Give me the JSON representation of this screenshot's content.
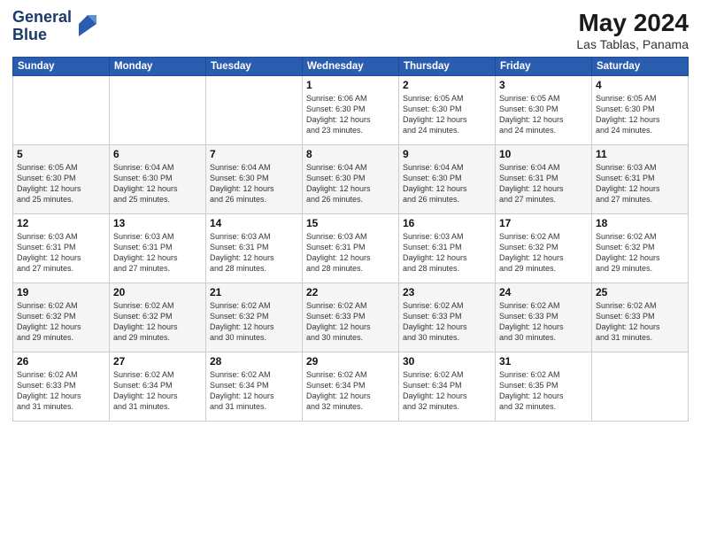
{
  "logo": {
    "line1": "General",
    "line2": "Blue"
  },
  "title": "May 2024",
  "subtitle": "Las Tablas, Panama",
  "weekdays": [
    "Sunday",
    "Monday",
    "Tuesday",
    "Wednesday",
    "Thursday",
    "Friday",
    "Saturday"
  ],
  "weeks": [
    [
      {
        "day": "",
        "info": ""
      },
      {
        "day": "",
        "info": ""
      },
      {
        "day": "",
        "info": ""
      },
      {
        "day": "1",
        "info": "Sunrise: 6:06 AM\nSunset: 6:30 PM\nDaylight: 12 hours\nand 23 minutes."
      },
      {
        "day": "2",
        "info": "Sunrise: 6:05 AM\nSunset: 6:30 PM\nDaylight: 12 hours\nand 24 minutes."
      },
      {
        "day": "3",
        "info": "Sunrise: 6:05 AM\nSunset: 6:30 PM\nDaylight: 12 hours\nand 24 minutes."
      },
      {
        "day": "4",
        "info": "Sunrise: 6:05 AM\nSunset: 6:30 PM\nDaylight: 12 hours\nand 24 minutes."
      }
    ],
    [
      {
        "day": "5",
        "info": "Sunrise: 6:05 AM\nSunset: 6:30 PM\nDaylight: 12 hours\nand 25 minutes."
      },
      {
        "day": "6",
        "info": "Sunrise: 6:04 AM\nSunset: 6:30 PM\nDaylight: 12 hours\nand 25 minutes."
      },
      {
        "day": "7",
        "info": "Sunrise: 6:04 AM\nSunset: 6:30 PM\nDaylight: 12 hours\nand 26 minutes."
      },
      {
        "day": "8",
        "info": "Sunrise: 6:04 AM\nSunset: 6:30 PM\nDaylight: 12 hours\nand 26 minutes."
      },
      {
        "day": "9",
        "info": "Sunrise: 6:04 AM\nSunset: 6:30 PM\nDaylight: 12 hours\nand 26 minutes."
      },
      {
        "day": "10",
        "info": "Sunrise: 6:04 AM\nSunset: 6:31 PM\nDaylight: 12 hours\nand 27 minutes."
      },
      {
        "day": "11",
        "info": "Sunrise: 6:03 AM\nSunset: 6:31 PM\nDaylight: 12 hours\nand 27 minutes."
      }
    ],
    [
      {
        "day": "12",
        "info": "Sunrise: 6:03 AM\nSunset: 6:31 PM\nDaylight: 12 hours\nand 27 minutes."
      },
      {
        "day": "13",
        "info": "Sunrise: 6:03 AM\nSunset: 6:31 PM\nDaylight: 12 hours\nand 27 minutes."
      },
      {
        "day": "14",
        "info": "Sunrise: 6:03 AM\nSunset: 6:31 PM\nDaylight: 12 hours\nand 28 minutes."
      },
      {
        "day": "15",
        "info": "Sunrise: 6:03 AM\nSunset: 6:31 PM\nDaylight: 12 hours\nand 28 minutes."
      },
      {
        "day": "16",
        "info": "Sunrise: 6:03 AM\nSunset: 6:31 PM\nDaylight: 12 hours\nand 28 minutes."
      },
      {
        "day": "17",
        "info": "Sunrise: 6:02 AM\nSunset: 6:32 PM\nDaylight: 12 hours\nand 29 minutes."
      },
      {
        "day": "18",
        "info": "Sunrise: 6:02 AM\nSunset: 6:32 PM\nDaylight: 12 hours\nand 29 minutes."
      }
    ],
    [
      {
        "day": "19",
        "info": "Sunrise: 6:02 AM\nSunset: 6:32 PM\nDaylight: 12 hours\nand 29 minutes."
      },
      {
        "day": "20",
        "info": "Sunrise: 6:02 AM\nSunset: 6:32 PM\nDaylight: 12 hours\nand 29 minutes."
      },
      {
        "day": "21",
        "info": "Sunrise: 6:02 AM\nSunset: 6:32 PM\nDaylight: 12 hours\nand 30 minutes."
      },
      {
        "day": "22",
        "info": "Sunrise: 6:02 AM\nSunset: 6:33 PM\nDaylight: 12 hours\nand 30 minutes."
      },
      {
        "day": "23",
        "info": "Sunrise: 6:02 AM\nSunset: 6:33 PM\nDaylight: 12 hours\nand 30 minutes."
      },
      {
        "day": "24",
        "info": "Sunrise: 6:02 AM\nSunset: 6:33 PM\nDaylight: 12 hours\nand 30 minutes."
      },
      {
        "day": "25",
        "info": "Sunrise: 6:02 AM\nSunset: 6:33 PM\nDaylight: 12 hours\nand 31 minutes."
      }
    ],
    [
      {
        "day": "26",
        "info": "Sunrise: 6:02 AM\nSunset: 6:33 PM\nDaylight: 12 hours\nand 31 minutes."
      },
      {
        "day": "27",
        "info": "Sunrise: 6:02 AM\nSunset: 6:34 PM\nDaylight: 12 hours\nand 31 minutes."
      },
      {
        "day": "28",
        "info": "Sunrise: 6:02 AM\nSunset: 6:34 PM\nDaylight: 12 hours\nand 31 minutes."
      },
      {
        "day": "29",
        "info": "Sunrise: 6:02 AM\nSunset: 6:34 PM\nDaylight: 12 hours\nand 32 minutes."
      },
      {
        "day": "30",
        "info": "Sunrise: 6:02 AM\nSunset: 6:34 PM\nDaylight: 12 hours\nand 32 minutes."
      },
      {
        "day": "31",
        "info": "Sunrise: 6:02 AM\nSunset: 6:35 PM\nDaylight: 12 hours\nand 32 minutes."
      },
      {
        "day": "",
        "info": ""
      }
    ]
  ]
}
